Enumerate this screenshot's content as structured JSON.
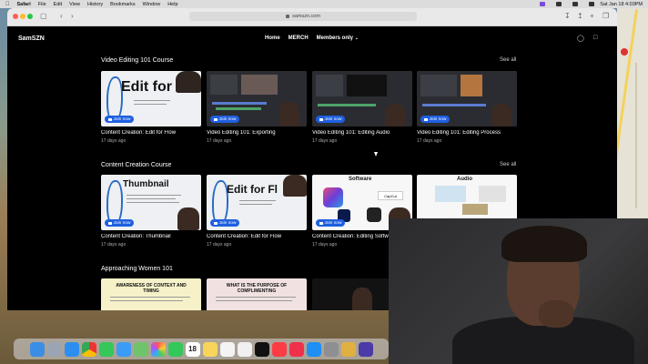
{
  "menubar": {
    "apple_icon": "apple-icon",
    "items": [
      "Safari",
      "File",
      "Edit",
      "View",
      "History",
      "Bookmarks",
      "Window",
      "Help"
    ],
    "clock": "Sat Jan 18  4:03PM"
  },
  "browser": {
    "url": "samszn.com",
    "lock_icon": "lock-icon"
  },
  "site": {
    "logo": "SamSZN",
    "nav": [
      "Home",
      "MERCH",
      "Members only"
    ],
    "nav_chevron": "chevron-down-icon",
    "account_icon": "person-icon",
    "cart_icon": "bag-icon"
  },
  "sections": [
    {
      "title": "Video Editing 101 Course",
      "see_all": "See all",
      "cards": [
        {
          "title": "Content Creation: Edit for Flow",
          "time": "17 days ago",
          "join": "Join now",
          "thumb_text": "Edit for F"
        },
        {
          "title": "Video Editing 101: Exporting",
          "time": "17 days ago",
          "join": "Join now",
          "thumb_text": ""
        },
        {
          "title": "Video Editing 101: Editing Audio",
          "time": "17 days ago",
          "join": "Join now",
          "thumb_text": ""
        },
        {
          "title": "Video Editing 101: Editing Process",
          "time": "17 days ago",
          "join": "Join now",
          "thumb_text": ""
        }
      ]
    },
    {
      "title": "Content Creation Course",
      "see_all": "See all",
      "cards": [
        {
          "title": "Content Creation: Thumbnail",
          "time": "17 days ago",
          "join": "Join now",
          "thumb_text": "Thumbnail"
        },
        {
          "title": "Content Creation: Edit for Flow",
          "time": "17 days ago",
          "join": "Join now",
          "thumb_text": "Edit for Fl"
        },
        {
          "title": "Content Creation: Editing Softw",
          "time": "17 days ago",
          "join": "Join now",
          "thumb_text": "Software",
          "thumb_sub": "CapCut"
        },
        {
          "title": "",
          "time": "",
          "join": "Join now",
          "thumb_text": "Audio"
        }
      ]
    },
    {
      "title": "Approaching Women 101",
      "see_all": "",
      "cards": [
        {
          "title": "",
          "time": "",
          "join": "",
          "thumb_text": "AWARENESS OF CONTEXT AND TIMING"
        },
        {
          "title": "",
          "time": "",
          "join": "",
          "thumb_text": "WHAT IS THE PURPOSE OF COMPLIMENTING"
        },
        {
          "title": "",
          "time": "",
          "join": "",
          "thumb_text": ""
        }
      ]
    }
  ],
  "dock": {
    "icons": [
      "finder-icon",
      "launchpad-icon",
      "safari-icon",
      "chrome-icon",
      "messages-icon",
      "mail-icon",
      "maps-icon",
      "photos-icon",
      "facetime-icon",
      "calendar-icon",
      "notes-icon",
      "reminders-icon",
      "freeform-icon",
      "appletv-icon",
      "music-icon",
      "news-icon",
      "appstore-icon",
      "settings-icon",
      "help-icon",
      "preview-icon"
    ],
    "calendar_day": "18"
  },
  "colors": {
    "join_button": "#1f5fe0",
    "page_bg": "#000000"
  }
}
